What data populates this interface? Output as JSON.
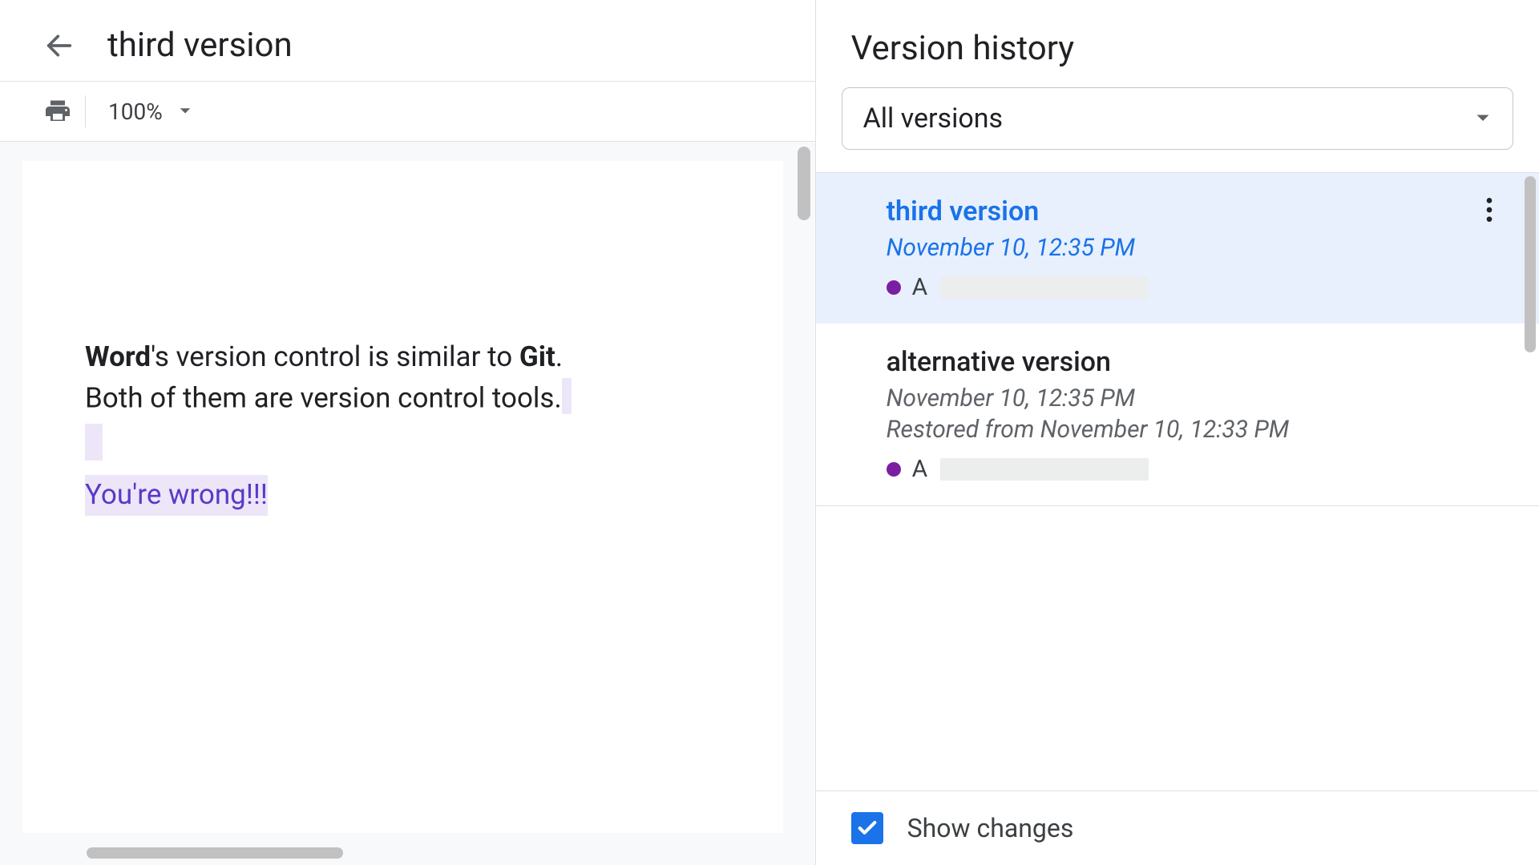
{
  "doc": {
    "title": "third version"
  },
  "toolbar": {
    "zoom": "100%"
  },
  "content": {
    "line1_bold1": "Word",
    "line1_mid": "'s version control is similar to ",
    "line1_bold2": "Git",
    "line1_end": ".",
    "line2": "Both of them are version control tools.",
    "added": "You're wrong!!!"
  },
  "panel": {
    "title": "Version history",
    "filter": "All versions",
    "show_changes": "Show changes"
  },
  "versions": [
    {
      "name": "third version",
      "date": "November 10, 12:35 PM",
      "author_initial": "A",
      "selected": true
    },
    {
      "name": "alternative version",
      "date": "November 10, 12:35 PM",
      "restored": "Restored from November 10, 12:33 PM",
      "author_initial": "A",
      "selected": false
    }
  ],
  "colors": {
    "accent": "#1a73e8",
    "author_dot": "#7b1fa2",
    "highlight": "#ece6f8",
    "added_text": "#5b39c6"
  }
}
